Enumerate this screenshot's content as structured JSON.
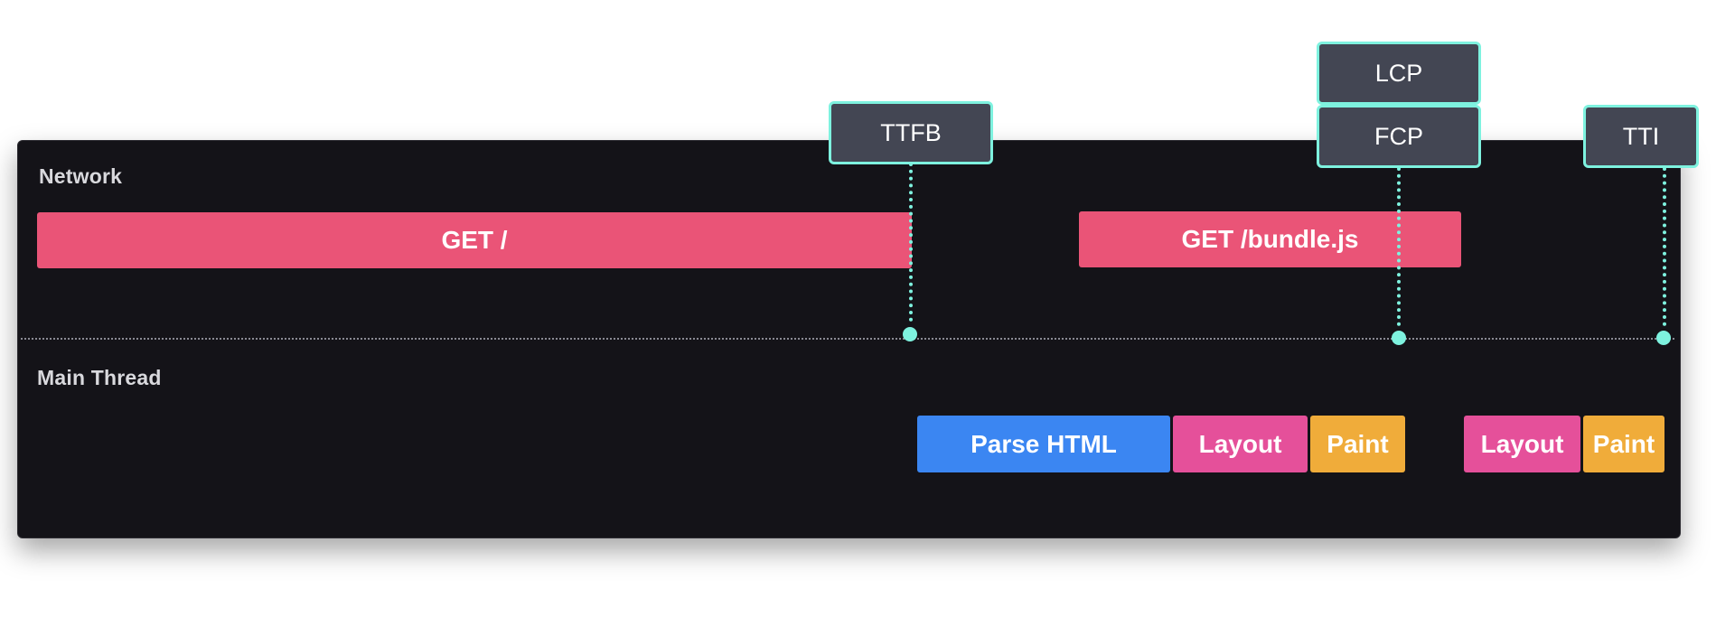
{
  "lanes": {
    "network": "Network",
    "main_thread": "Main Thread"
  },
  "network_tasks": [
    {
      "label": "GET /"
    },
    {
      "label": "GET /bundle.js"
    }
  ],
  "main_tasks": [
    {
      "label": "Parse HTML"
    },
    {
      "label": "Layout"
    },
    {
      "label": "Paint"
    },
    {
      "label": "Layout"
    },
    {
      "label": "Paint"
    }
  ],
  "markers": [
    {
      "label": "TTFB"
    },
    {
      "label": "LCP"
    },
    {
      "label": "FCP"
    },
    {
      "label": "TTI"
    }
  ],
  "colors": {
    "network": "#ea5477",
    "parse": "#3b86f2",
    "layout": "#e5509a",
    "paint": "#f0ac3a",
    "marker_border": "#7ef2df",
    "panel": "#141318"
  }
}
